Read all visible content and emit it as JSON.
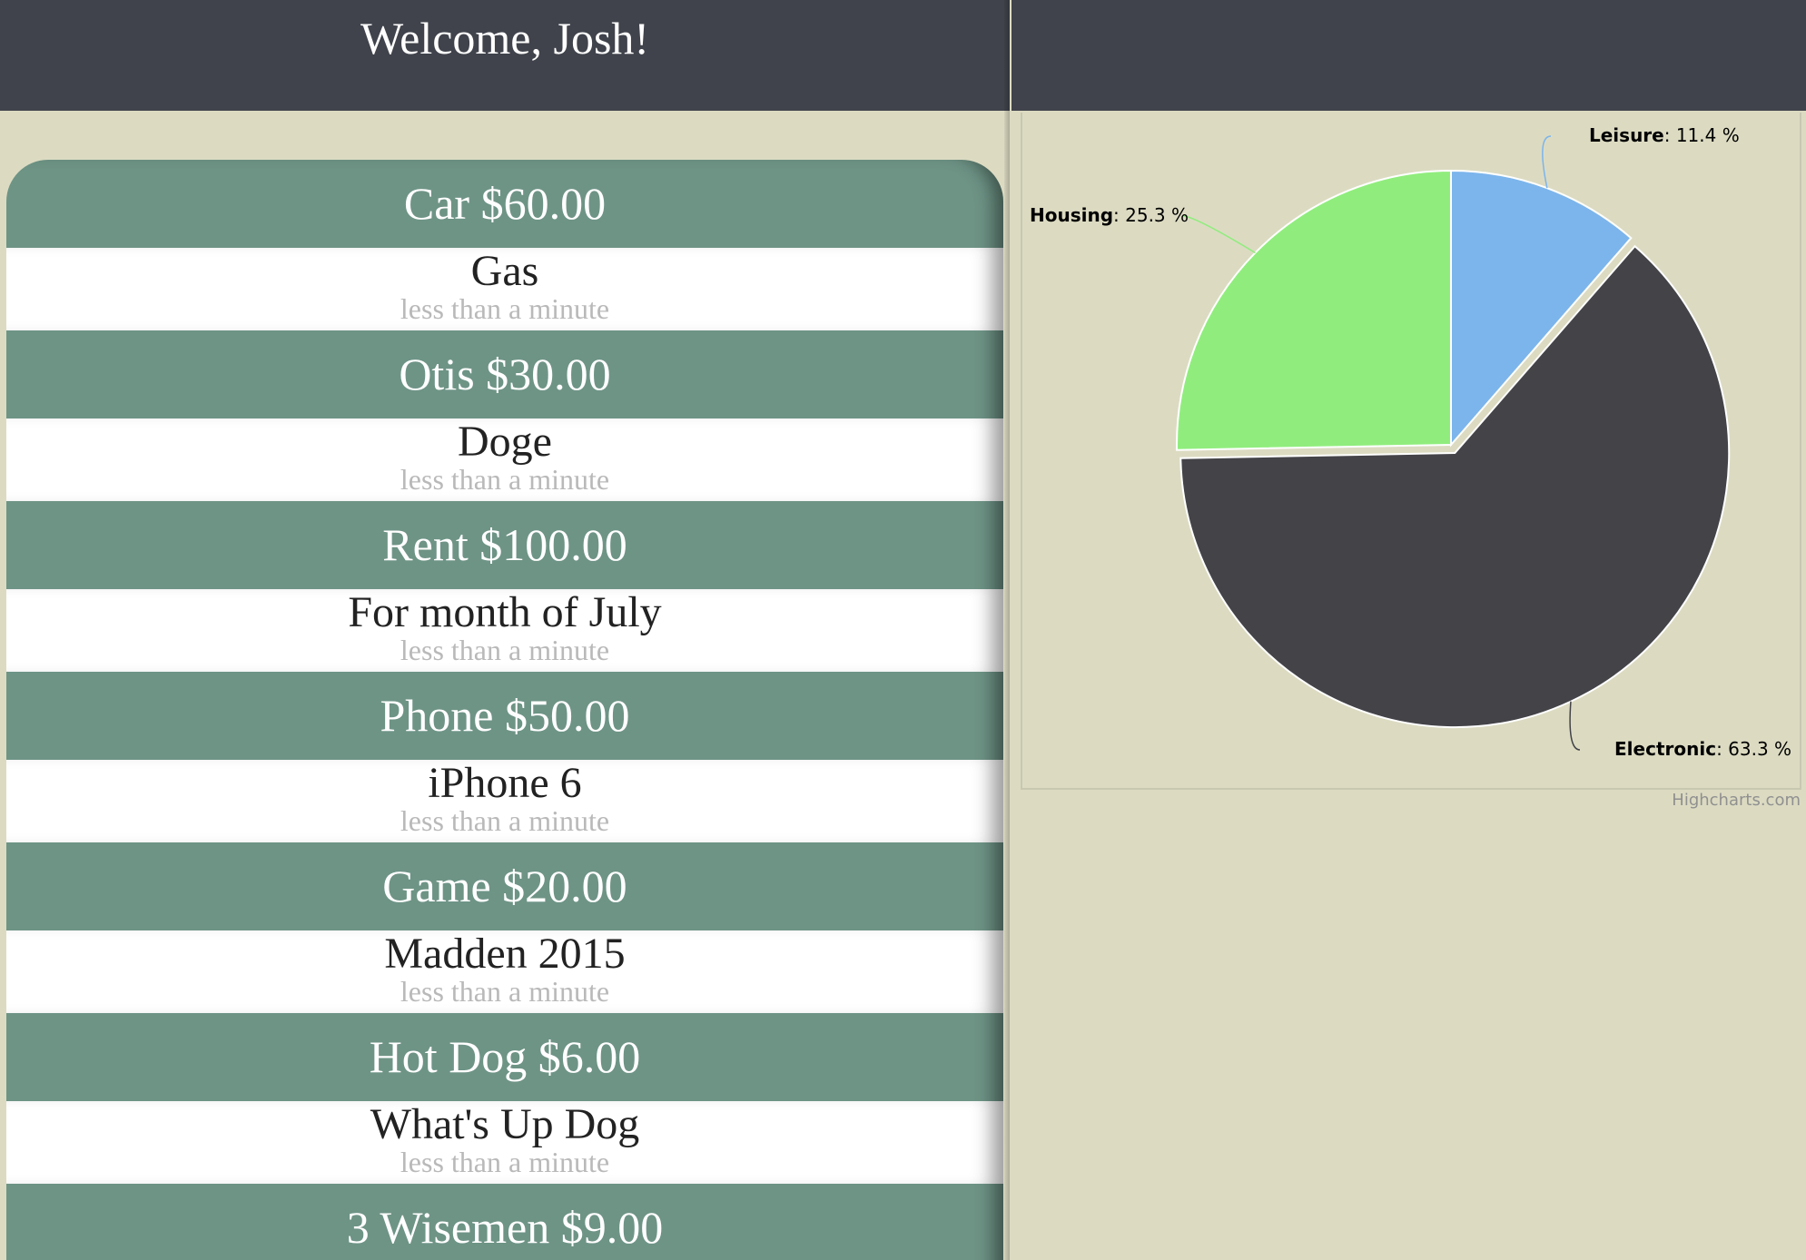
{
  "header": {
    "welcome": "Welcome, Josh!"
  },
  "expenses": [
    {
      "title": "Car $60.00",
      "description": "Gas",
      "time": "less than a minute"
    },
    {
      "title": "Otis $30.00",
      "description": "Doge",
      "time": "less than a minute"
    },
    {
      "title": "Rent $100.00",
      "description": "For month of July",
      "time": "less than a minute"
    },
    {
      "title": "Phone $50.00",
      "description": "iPhone 6",
      "time": "less than a minute"
    },
    {
      "title": "Game $20.00",
      "description": "Madden 2015",
      "time": "less than a minute"
    },
    {
      "title": "Hot Dog $6.00",
      "description": "What's Up Dog",
      "time": "less than a minute"
    },
    {
      "title": "3 Wisemen $9.00",
      "description": "",
      "time": ""
    }
  ],
  "chart_credit": "Highcharts.com",
  "colors": {
    "header": "#40434b",
    "background": "#dcdbc2",
    "row_title": "#6e9486"
  },
  "chart_data": {
    "type": "pie",
    "title": "",
    "series": [
      {
        "name": "Leisure",
        "value": 11.4,
        "label": "11.4 %",
        "color": "#7cb5ec"
      },
      {
        "name": "Electronic",
        "value": 63.3,
        "label": "63.3 %",
        "color": "#434348",
        "sliced": true
      },
      {
        "name": "Housing",
        "value": 25.3,
        "label": "25.3 %",
        "color": "#90ed7d"
      }
    ],
    "legend": "none",
    "start_angle_deg": 0
  }
}
